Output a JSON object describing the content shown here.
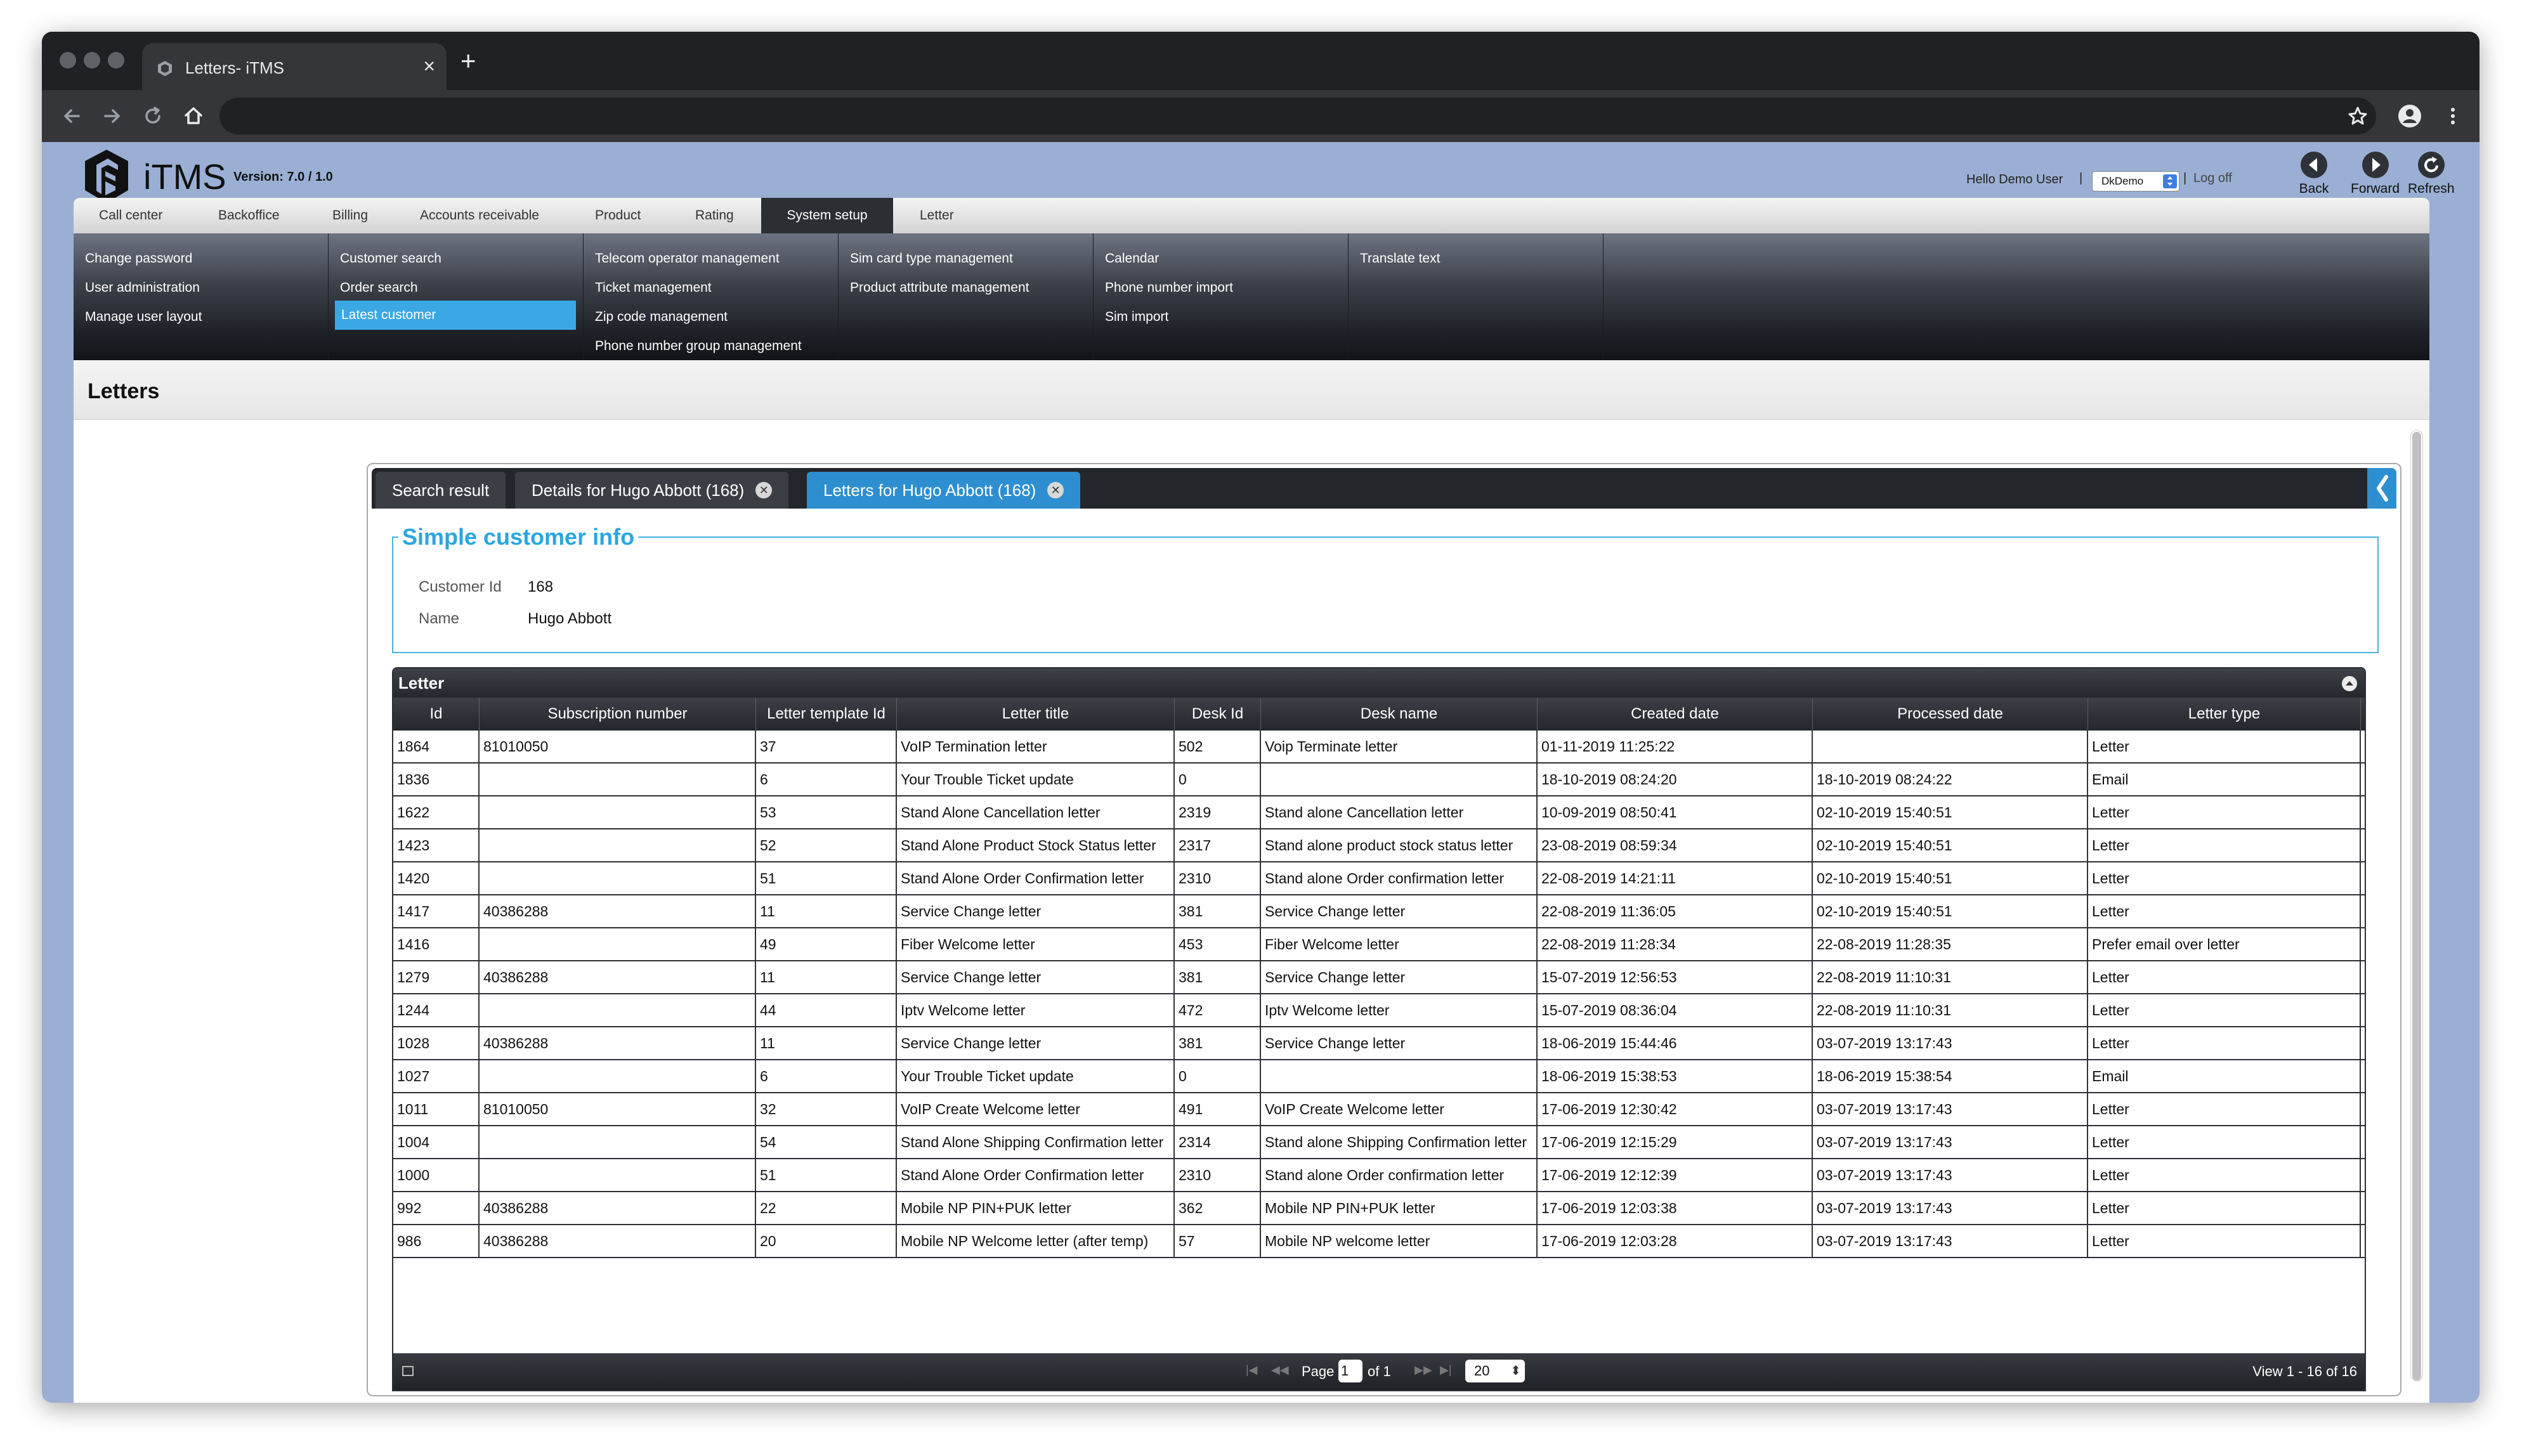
{
  "browser": {
    "tab_title": "Letters- iTMS",
    "tab_close": "×",
    "new_tab": "+"
  },
  "app": {
    "name": "iTMS",
    "version": "Version: 7.0 / 1.0",
    "greeting": "Hello Demo User",
    "separator": "|",
    "company": "DkDemo",
    "logoff": "Log off",
    "back": "Back",
    "forward": "Forward",
    "refresh": "Refresh"
  },
  "menu": {
    "tabs": [
      "Call center",
      "Backoffice",
      "Billing",
      "Accounts receivable",
      "Product",
      "Rating",
      "System setup",
      "Letter"
    ],
    "active_tab": "System setup",
    "columns": [
      [
        "Change password",
        "User administration",
        "Manage user layout"
      ],
      [
        "Customer search",
        "Order search",
        "Latest customer"
      ],
      [
        "Telecom operator management",
        "Ticket management",
        "Zip code management",
        "Phone number group management"
      ],
      [
        "Sim card type management",
        "Product attribute management"
      ],
      [
        "Calendar",
        "Phone number import",
        "Sim import"
      ],
      [
        "Translate text"
      ]
    ],
    "selected_item": "Latest customer"
  },
  "page": {
    "title": "Letters"
  },
  "panel_tabs": [
    {
      "label": "Search result",
      "closable": false
    },
    {
      "label": "Details for Hugo Abbott (168)",
      "closable": true
    },
    {
      "label": "Letters for Hugo Abbott (168)",
      "closable": true,
      "active": true
    }
  ],
  "customer_info": {
    "legend": "Simple customer info",
    "id_label": "Customer Id",
    "id_value": "168",
    "name_label": "Name",
    "name_value": "Hugo Abbott"
  },
  "letters": {
    "caption": "Letter",
    "columns": [
      "Id",
      "Subscription number",
      "Letter template Id",
      "Letter title",
      "Desk Id",
      "Desk name",
      "Created date",
      "Processed date",
      "Letter type"
    ],
    "rows": [
      [
        "1864",
        "81010050",
        "37",
        "VoIP Termination letter",
        "502",
        "Voip Terminate letter",
        "01-11-2019 11:25:22",
        "",
        "Letter"
      ],
      [
        "1836",
        "",
        "6",
        "Your Trouble Ticket update",
        "0",
        "",
        "18-10-2019 08:24:20",
        "18-10-2019 08:24:22",
        "Email"
      ],
      [
        "1622",
        "",
        "53",
        "Stand Alone Cancellation letter",
        "2319",
        "Stand alone Cancellation letter",
        "10-09-2019 08:50:41",
        "02-10-2019 15:40:51",
        "Letter"
      ],
      [
        "1423",
        "",
        "52",
        "Stand Alone Product Stock Status letter",
        "2317",
        "Stand alone product stock status letter",
        "23-08-2019 08:59:34",
        "02-10-2019 15:40:51",
        "Letter"
      ],
      [
        "1420",
        "",
        "51",
        "Stand Alone Order Confirmation letter",
        "2310",
        "Stand alone Order confirmation letter",
        "22-08-2019 14:21:11",
        "02-10-2019 15:40:51",
        "Letter"
      ],
      [
        "1417",
        "40386288",
        "11",
        "Service Change letter",
        "381",
        "Service Change letter",
        "22-08-2019 11:36:05",
        "02-10-2019 15:40:51",
        "Letter"
      ],
      [
        "1416",
        "",
        "49",
        "Fiber Welcome letter",
        "453",
        "Fiber Welcome letter",
        "22-08-2019 11:28:34",
        "22-08-2019 11:28:35",
        "Prefer email over letter"
      ],
      [
        "1279",
        "40386288",
        "11",
        "Service Change letter",
        "381",
        "Service Change letter",
        "15-07-2019 12:56:53",
        "22-08-2019 11:10:31",
        "Letter"
      ],
      [
        "1244",
        "",
        "44",
        "Iptv Welcome letter",
        "472",
        "Iptv Welcome letter",
        "15-07-2019 08:36:04",
        "22-08-2019 11:10:31",
        "Letter"
      ],
      [
        "1028",
        "40386288",
        "11",
        "Service Change letter",
        "381",
        "Service Change letter",
        "18-06-2019 15:44:46",
        "03-07-2019 13:17:43",
        "Letter"
      ],
      [
        "1027",
        "",
        "6",
        "Your Trouble Ticket update",
        "0",
        "",
        "18-06-2019 15:38:53",
        "18-06-2019 15:38:54",
        "Email"
      ],
      [
        "1011",
        "81010050",
        "32",
        "VoIP Create Welcome letter",
        "491",
        "VoIP Create Welcome letter",
        "17-06-2019 12:30:42",
        "03-07-2019 13:17:43",
        "Letter"
      ],
      [
        "1004",
        "",
        "54",
        "Stand Alone Shipping Confirmation letter",
        "2314",
        "Stand alone Shipping Confirmation letter",
        "17-06-2019 12:15:29",
        "03-07-2019 13:17:43",
        "Letter"
      ],
      [
        "1000",
        "",
        "51",
        "Stand Alone Order Confirmation letter",
        "2310",
        "Stand alone Order confirmation letter",
        "17-06-2019 12:12:39",
        "03-07-2019 13:17:43",
        "Letter"
      ],
      [
        "992",
        "40386288",
        "22",
        "Mobile NP PIN+PUK letter",
        "362",
        "Mobile NP PIN+PUK letter",
        "17-06-2019 12:03:38",
        "03-07-2019 13:17:43",
        "Letter"
      ],
      [
        "986",
        "40386288",
        "20",
        "Mobile NP Welcome letter (after temp)",
        "57",
        "Mobile NP welcome letter",
        "17-06-2019 12:03:28",
        "03-07-2019 13:17:43",
        "Letter"
      ]
    ]
  },
  "pager": {
    "page_label": "Page",
    "page_value": "1",
    "of_label": "of 1",
    "page_size": "20",
    "view_text": "View 1 - 16 of 16",
    "nav_first": "|◀",
    "nav_prev": "◀◀",
    "nav_next": "▶▶",
    "nav_last": "▶|"
  },
  "colors": {
    "accent_blue": "#2d8fd0",
    "selected_menu": "#3ba8e5",
    "legend_blue": "#2aa6e0",
    "frame_bg": "#9aafd3"
  }
}
